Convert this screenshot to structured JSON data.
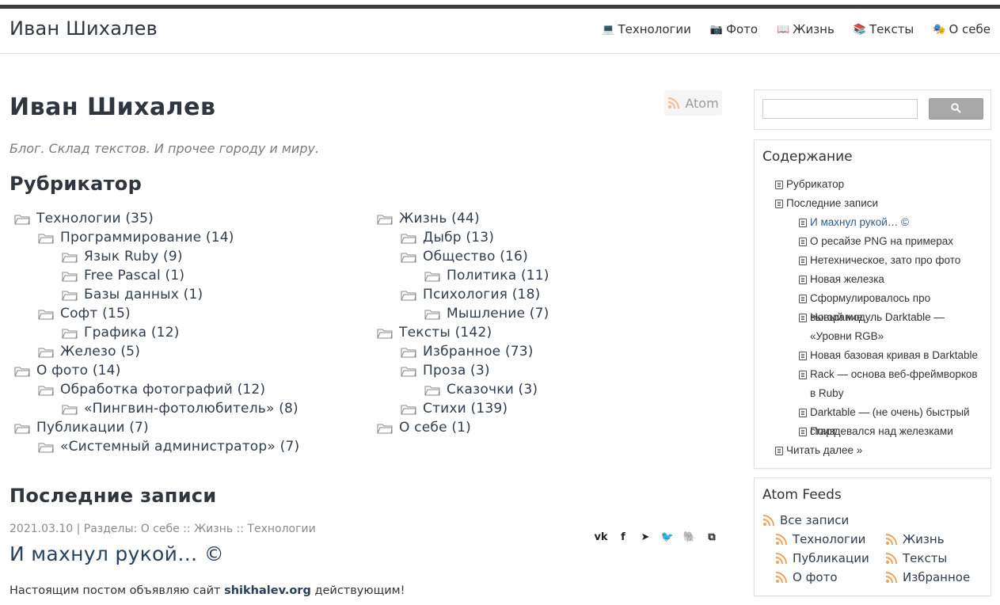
{
  "header": {
    "site_title": "Иван Шихалев",
    "nav": [
      {
        "label": "Технологии",
        "icon": "laptop-icon",
        "glyph": "💻"
      },
      {
        "label": "Фото",
        "icon": "camera-icon",
        "glyph": "📷"
      },
      {
        "label": "Жизнь",
        "icon": "book-icon",
        "glyph": "📖"
      },
      {
        "label": "Тексты",
        "icon": "books-icon",
        "glyph": "📚"
      },
      {
        "label": "О себе",
        "icon": "masks-icon",
        "glyph": "🎭"
      }
    ]
  },
  "main": {
    "atom_label": "Atom",
    "title": "Иван Шихалев",
    "subtitle": "Блог. Склад текстов. И прочее городу и миру.",
    "rubricator_heading": "Рубрикатор",
    "tree_left": [
      {
        "label": "Технологии (35)",
        "level": 0
      },
      {
        "label": "Программирование (14)",
        "level": 1
      },
      {
        "label": "Язык Ruby (9)",
        "level": 2
      },
      {
        "label": "Free Pascal (1)",
        "level": 2
      },
      {
        "label": "Базы данных (1)",
        "level": 2
      },
      {
        "label": "Софт (15)",
        "level": 1
      },
      {
        "label": "Графика (12)",
        "level": 2
      },
      {
        "label": "Железо (5)",
        "level": 1
      },
      {
        "label": "О фото (14)",
        "level": 0
      },
      {
        "label": "Обработка фотографий (12)",
        "level": 1
      },
      {
        "label": "«Пингвин-фотолюбитель» (8)",
        "level": 2
      },
      {
        "label": "Публикации (7)",
        "level": 0
      },
      {
        "label": "«Системный администратор» (7)",
        "level": 1
      }
    ],
    "tree_right": [
      {
        "label": "Жизнь (44)",
        "level": 0
      },
      {
        "label": "Дыбр (13)",
        "level": 1
      },
      {
        "label": "Общество (16)",
        "level": 1
      },
      {
        "label": "Политика (11)",
        "level": 2
      },
      {
        "label": "Психология (18)",
        "level": 1
      },
      {
        "label": "Мышление (7)",
        "level": 2
      },
      {
        "label": "Тексты (142)",
        "level": 0
      },
      {
        "label": "Избранное (73)",
        "level": 1
      },
      {
        "label": "Проза (3)",
        "level": 1
      },
      {
        "label": "Сказочки (3)",
        "level": 2
      },
      {
        "label": "Стихи (139)",
        "level": 1
      },
      {
        "label": "О себе (1)",
        "level": 0
      }
    ],
    "recent_heading": "Последние записи",
    "post": {
      "meta": "2021.03.10 | Разделы: О себе :: Жизнь :: Технологии",
      "title": "И махнул рукой… ©",
      "body_before": "Настоящим постом объявляю сайт ",
      "body_link": "shikhalev.org",
      "body_after": " действующим!",
      "share": [
        {
          "icon": "vk-icon",
          "glyph": "vk"
        },
        {
          "icon": "facebook-icon",
          "glyph": "f"
        },
        {
          "icon": "telegram-icon",
          "glyph": "➤"
        },
        {
          "icon": "twitter-icon",
          "glyph": "🐦"
        },
        {
          "icon": "evernote-icon",
          "glyph": "🐘"
        },
        {
          "icon": "copy-icon",
          "glyph": "⧉"
        }
      ]
    }
  },
  "sidebar": {
    "search_icon": "search-icon",
    "toc_title": "Содержание",
    "toc": [
      {
        "label": "Рубрикатор",
        "level": 0,
        "active": false
      },
      {
        "label": "Последние записи",
        "level": 0,
        "active": false
      },
      {
        "label": "И махнул рукой… ©",
        "level": 1,
        "active": true
      },
      {
        "label": "О ресайзе PNG на примерах",
        "level": 1,
        "active": false
      },
      {
        "label": "Нетехническое, зато про фото",
        "level": 1,
        "active": false
      },
      {
        "label": "Новая железка",
        "level": 1,
        "active": false
      },
      {
        "label": "Сформулировалось про выгорание…",
        "level": 1,
        "active": false
      },
      {
        "label": "Новый модуль Darktable —",
        "label2": "«Уровни RGB»",
        "level": 1,
        "active": false
      },
      {
        "label": "Новая базовая кривая в Darktable",
        "level": 1,
        "active": false
      },
      {
        "label": "Rack — основа веб-фреймворков",
        "label2": "в Ruby",
        "level": 1,
        "active": false
      },
      {
        "label": "Darktable — (не очень) быстрый старт",
        "level": 1,
        "active": false
      },
      {
        "label": "Поиздевался над железками",
        "level": 1,
        "active": false
      },
      {
        "label": "Читать далее »",
        "level": 0,
        "active": false
      }
    ],
    "feeds_title": "Atom Feeds",
    "feeds_all": "Все записи",
    "feeds_left": [
      "Технологии",
      "Публикации",
      "О фото"
    ],
    "feeds_right": [
      "Жизнь",
      "Тексты",
      "Избранное"
    ]
  },
  "colors": {
    "accent": "#f0a25a",
    "link": "#26415d",
    "text": "#2f3d4d"
  }
}
